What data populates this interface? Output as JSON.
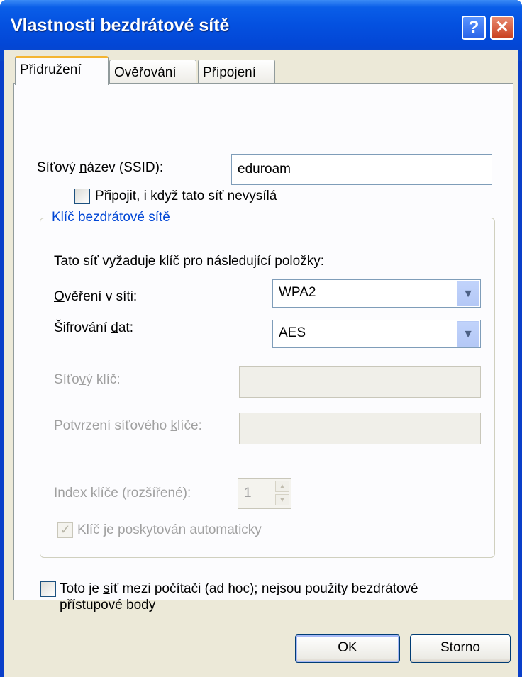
{
  "window": {
    "title": "Vlastnosti bezdrátové sítě",
    "help_label": "?",
    "close_label": "✕"
  },
  "tabs": [
    {
      "label": "Přidružení",
      "active": true
    },
    {
      "label": "Ověřování",
      "active": false
    },
    {
      "label": "Připojení",
      "active": false
    }
  ],
  "ssid": {
    "label_pre": "Síťový ",
    "label_mnemonic": "n",
    "label_post": "ázev (SSID):",
    "value": "eduroam"
  },
  "connect_hidden": {
    "label_mnemonic": "P",
    "label_post": "řipojit, i když tato síť nevysílá",
    "checked": false
  },
  "wireless_key": {
    "group_title": "Klíč bezdrátové sítě",
    "intro": "Tato síť vyžaduje klíč pro následující položky:",
    "auth": {
      "label_mnemonic": "O",
      "label_post": "věření v síti:",
      "value": "WPA2"
    },
    "encryption": {
      "label_pre": "Šifrování ",
      "label_mnemonic": "d",
      "label_post": "at:",
      "value": "AES"
    },
    "network_key": {
      "label_pre": "Síťo",
      "label_mnemonic": "v",
      "label_post": "ý klíč:",
      "value": ""
    },
    "confirm_key": {
      "label_pre": "Potvrzení síťového ",
      "label_mnemonic": "k",
      "label_post": "líče:",
      "value": ""
    },
    "key_index": {
      "label_pre": "Inde",
      "label_mnemonic": "x",
      "label_post": " klíče (rozšířené):",
      "value": "1"
    },
    "auto_key": {
      "label": "Klíč je poskytován automaticky",
      "checked": true
    }
  },
  "adhoc": {
    "label_line1_pre": "Toto je ",
    "label_mnemonic": "s",
    "label_line1_post": "íť mezi počítači (ad hoc); nejsou použity bezdrátové",
    "label_line2": "přístupové body",
    "checked": false
  },
  "buttons": {
    "ok": "OK",
    "cancel": "Storno"
  }
}
